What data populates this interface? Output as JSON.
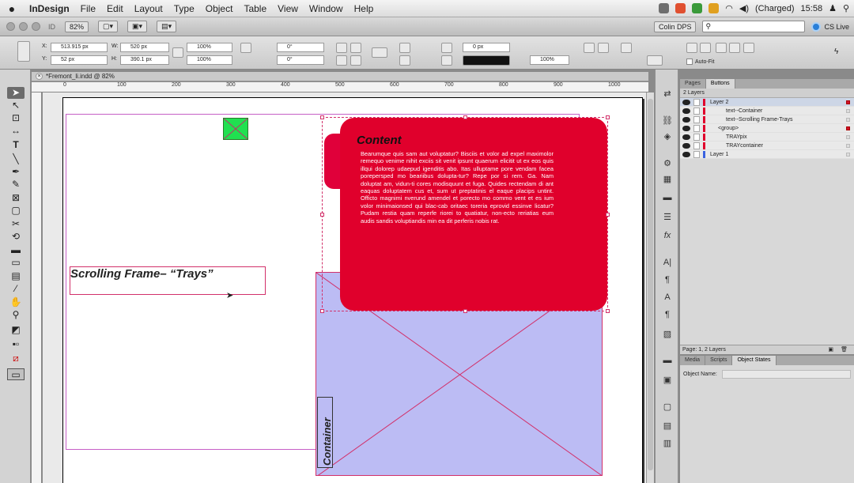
{
  "menubar": {
    "app_name": "InDesign",
    "items": [
      "File",
      "Edit",
      "Layout",
      "Type",
      "Object",
      "Table",
      "View",
      "Window",
      "Help"
    ],
    "battery": "(Charged)",
    "clock": "15:58"
  },
  "appbar": {
    "zoom": "82%",
    "workspace": "Colin DPS",
    "search_placeholder": "",
    "cs_live": "CS Live"
  },
  "control_panel": {
    "x_label": "X:",
    "x_value": "513.915 px",
    "y_label": "Y:",
    "y_value": "52 px",
    "w_label": "W:",
    "w_value": "520 px",
    "h_label": "H:",
    "h_value": "390.1 px",
    "scale_x": "100%",
    "scale_y": "100%",
    "rotate": "0°",
    "shear": "0°",
    "stroke": "0 px",
    "opacity": "100%",
    "auto_fit": "Auto-Fit"
  },
  "document": {
    "tab_title": "*Fremont_li.indd @ 82%",
    "ruler_labels": [
      "0",
      "100",
      "200",
      "300",
      "400",
      "500",
      "600",
      "700",
      "800",
      "900",
      "1000"
    ],
    "scrolling_frame_title": "Scrolling Frame– “Trays”",
    "container_label": "Container",
    "content_heading": "Content",
    "content_body": "Bearumque quis sam aut voluptatur? Bisciis et volor ad expel maximolor remequo venime nihit exciis sit venit ipsunt quaerum elicitit ut ex eos quis illqui dolorep udaepud igenditis abo. Itas ulluptame pore vendam facea porepersped mo beariibus dolupta-tur? Repe por si rem. Ga. Nam doluptat am, vidun-ti cores modisquunt et fuga. Quides rectendam di ant eaquas doluptatem cus et, sum ut preptatinis el eaque placips untint. Officto magnimi nverund amendel et porecto mo commo vent et es ium volor minimaionsed qui blac-cab oritaec toreria eprovid essinve licatur? Pudam restia quam reperfe riorei to quatiatur, non-ecto reriatias eum audis sandis voluptiandis min ea dit perferis nobis rat."
  },
  "layers_panel": {
    "tabs": [
      "Pages",
      "Buttons"
    ],
    "header": "2 Layers",
    "rows": [
      {
        "name": "Layer 2",
        "indent": 0
      },
      {
        "name": "text--Container",
        "indent": 2
      },
      {
        "name": "text--Scrolling Frame-Trays",
        "indent": 2
      },
      {
        "name": "<group>",
        "indent": 1
      },
      {
        "name": "TRAYpix",
        "indent": 2
      },
      {
        "name": "TRAYcontainer",
        "indent": 2
      },
      {
        "name": "Layer 1",
        "indent": 0
      }
    ],
    "footer": "Page: 1, 2 Layers"
  },
  "object_states_panel": {
    "tabs": [
      "Media",
      "Scripts",
      "Object States"
    ],
    "object_name_label": "Object Name:"
  },
  "colors": {
    "accent_red": "#e0002c",
    "container_fill": "#bcbcf4",
    "frame_stroke": "#d2306a",
    "green_box": "#20e050"
  }
}
